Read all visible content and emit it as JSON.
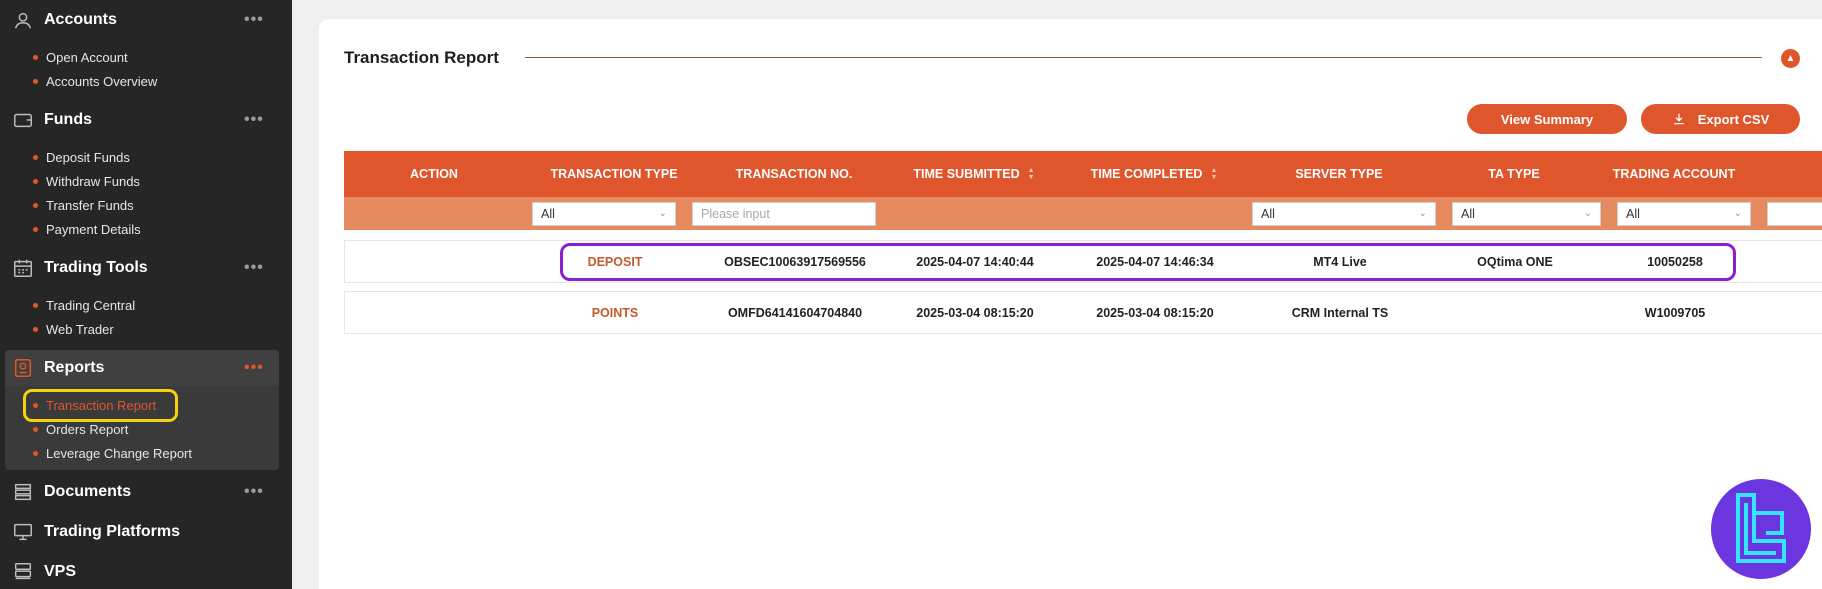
{
  "sidebar": {
    "sections": [
      {
        "title": "Accounts",
        "icon": "users-icon",
        "items": [
          "Open Account",
          "Accounts Overview"
        ]
      },
      {
        "title": "Funds",
        "icon": "wallet-icon",
        "items": [
          "Deposit Funds",
          "Withdraw Funds",
          "Transfer Funds",
          "Payment Details"
        ]
      },
      {
        "title": "Trading Tools",
        "icon": "calendar-icon",
        "items": [
          "Trading Central",
          "Web Trader"
        ]
      },
      {
        "title": "Reports",
        "icon": "report-icon",
        "items": [
          "Transaction Report",
          "Orders Report",
          "Leverage Change Report"
        ]
      },
      {
        "title": "Documents",
        "icon": "documents-icon"
      },
      {
        "title": "Trading Platforms",
        "icon": "platforms-icon"
      },
      {
        "title": "VPS",
        "icon": "server-icon"
      }
    ],
    "more": "•••"
  },
  "report": {
    "title": "Transaction Report",
    "buttons": {
      "summary": "View Summary",
      "export": "Export CSV"
    },
    "columns": [
      "ACTION",
      "TRANSACTION TYPE",
      "TRANSACTION NO.",
      "TIME SUBMITTED",
      "TIME COMPLETED",
      "SERVER TYPE",
      "TA TYPE",
      "TRADING ACCOUNT"
    ],
    "filters": {
      "type": "All",
      "number_placeholder": "Please input",
      "server": "All",
      "ta_type": "All",
      "account": "All"
    },
    "rows": [
      {
        "type": "DEPOSIT",
        "number": "OBSEC10063917569556",
        "submitted": "2025-04-07 14:40:44",
        "completed": "2025-04-07 14:46:34",
        "server": "MT4 Live",
        "ta_type": "OQtima ONE",
        "account": "10050258"
      },
      {
        "type": "POINTS",
        "number": "OMFD64141604704840",
        "submitted": "2025-03-04 08:15:20",
        "completed": "2025-03-04 08:15:20",
        "server": "CRM Internal TS",
        "ta_type": "",
        "account": "W1009705"
      }
    ]
  },
  "colors": {
    "accent": "#e0562c",
    "sidebar": "#262626",
    "highlight_yellow": "#f5d10f",
    "highlight_purple": "#8a1fd1"
  }
}
